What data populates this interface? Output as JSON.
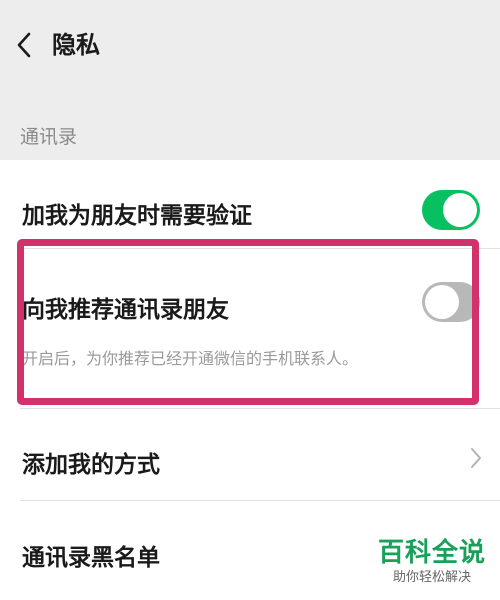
{
  "header": {
    "back_icon": "chevron-left-icon",
    "title": "隐私"
  },
  "section": {
    "contacts_label": "通讯录"
  },
  "settings": {
    "verify_friend": {
      "label": "加我为朋友时需要验证",
      "enabled": true
    },
    "recommend_contacts": {
      "label": "向我推荐通讯录朋友",
      "enabled": false,
      "description": "开启后，为你推荐已经开通微信的手机联系人。"
    },
    "add_methods": {
      "label": "添加我的方式",
      "icon": "chevron-right-icon"
    },
    "blacklist": {
      "label": "通讯录黑名单"
    }
  },
  "watermark": {
    "logo_text": "百科全说",
    "slogan": "助你轻松解决"
  },
  "colors": {
    "toggle_on": "#07c160",
    "toggle_off": "#b8b8b8",
    "highlight_border": "#d1326c",
    "watermark_green": "#1aa05a"
  }
}
